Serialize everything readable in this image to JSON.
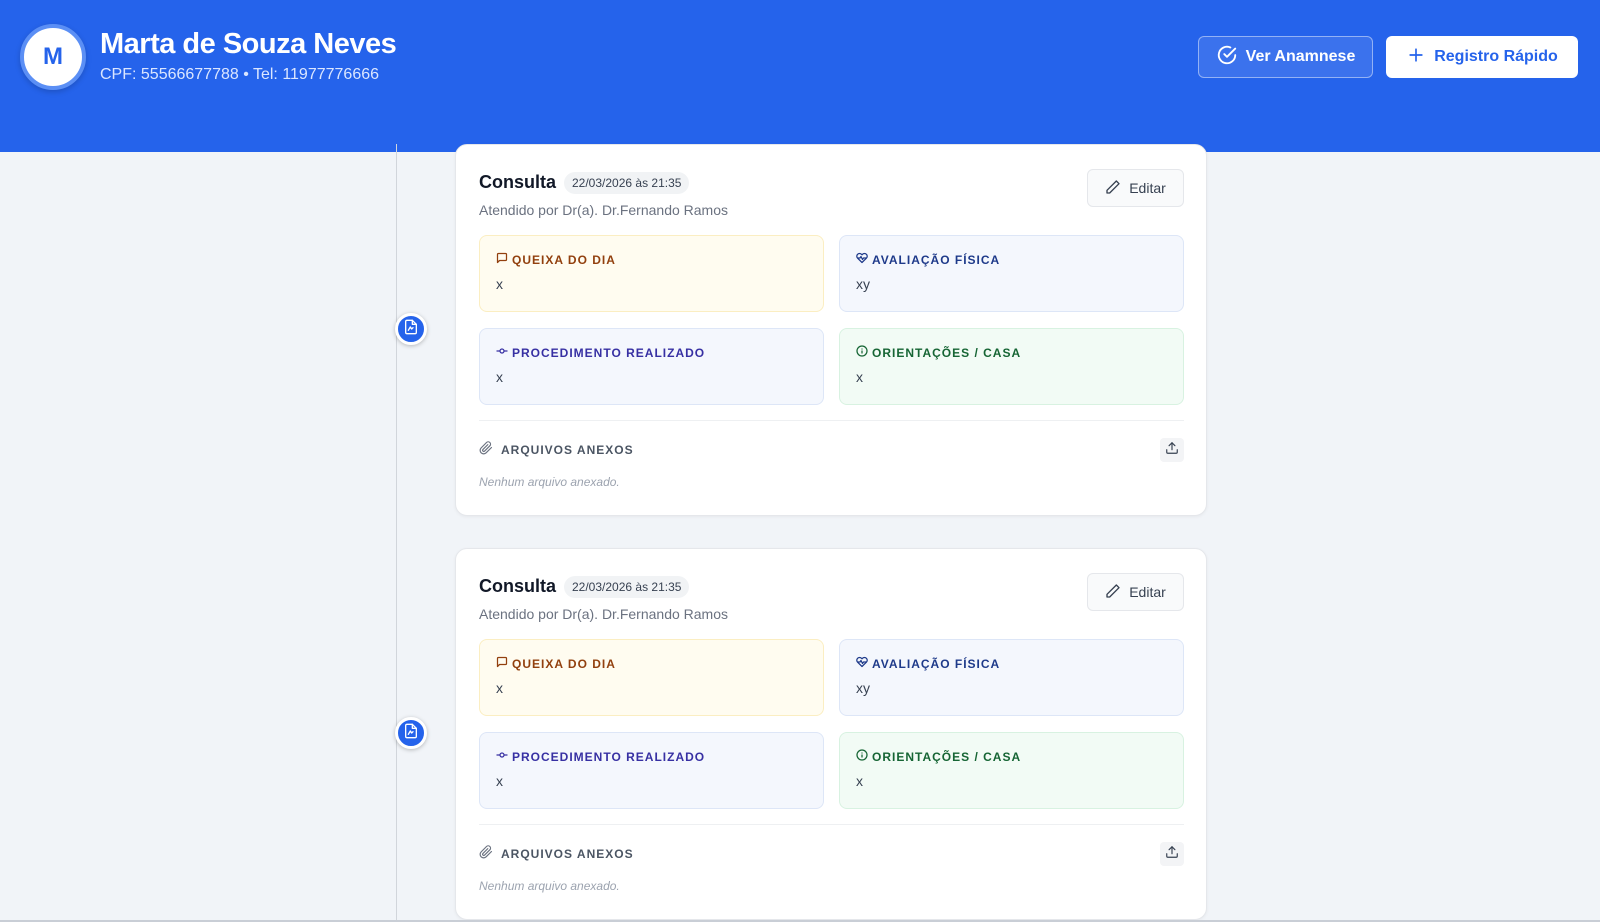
{
  "header": {
    "avatar_initial": "M",
    "patient_name": "Marta de Souza Neves",
    "patient_meta": "CPF: 55566677788 • Tel: 11977776666",
    "ver_anamnese_label": "Ver Anamnese",
    "registro_rapido_label": "Registro Rápido"
  },
  "colors": {
    "brand_blue": "#2563eb",
    "queixa": "#92400e",
    "avaliacao": "#1e3a8a",
    "procedimento": "#3730a3",
    "orientacoes": "#166534"
  },
  "records": [
    {
      "title": "Consulta",
      "date": "22/03/2026 às 21:35",
      "attended_by": "Atendido por Dr(a). Dr.Fernando Ramos",
      "edit_label": "Editar",
      "sections": {
        "queixa": {
          "label": "QUEIXA DO DIA",
          "value": "x",
          "icon": "message-square-icon"
        },
        "avaliacao": {
          "label": "AVALIAÇÃO FÍSICA",
          "value": "xy",
          "icon": "heart-pulse-icon"
        },
        "procedimento": {
          "label": "PROCEDIMENTO REALIZADO",
          "value": "x",
          "icon": "git-commit-icon"
        },
        "orientacoes": {
          "label": "ORIENTAÇÕES / CASA",
          "value": "x",
          "icon": "info-icon"
        }
      },
      "attachments_label": "ARQUIVOS ANEXOS",
      "no_files": "Nenhum arquivo anexado."
    },
    {
      "title": "Consulta",
      "date": "22/03/2026 às 21:35",
      "attended_by": "Atendido por Dr(a). Dr.Fernando Ramos",
      "edit_label": "Editar",
      "sections": {
        "queixa": {
          "label": "QUEIXA DO DIA",
          "value": "x",
          "icon": "message-square-icon"
        },
        "avaliacao": {
          "label": "AVALIAÇÃO FÍSICA",
          "value": "xy",
          "icon": "heart-pulse-icon"
        },
        "procedimento": {
          "label": "PROCEDIMENTO REALIZADO",
          "value": "x",
          "icon": "git-commit-icon"
        },
        "orientacoes": {
          "label": "ORIENTAÇÕES / CASA",
          "value": "x",
          "icon": "info-icon"
        }
      },
      "attachments_label": "ARQUIVOS ANEXOS",
      "no_files": "Nenhum arquivo anexado."
    }
  ]
}
